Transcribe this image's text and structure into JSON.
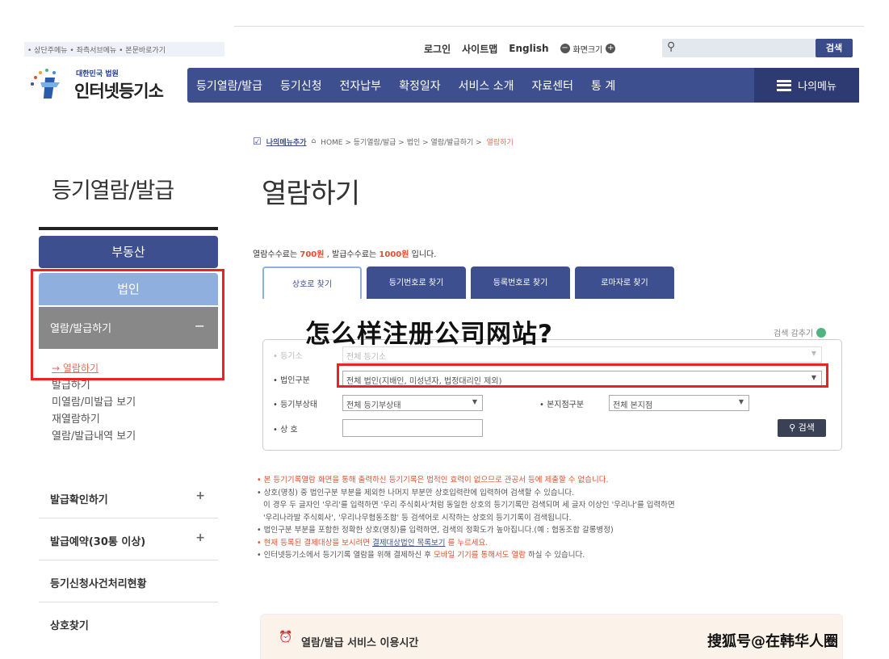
{
  "skip_links": "• 상단주메뉴 • 좌측서브메뉴 • 본문바로가기",
  "utils": {
    "login": "로그인",
    "sitemap": "사이트맵",
    "english": "English",
    "zoom": "화면크기",
    "minus": "−",
    "plus": "+",
    "search_btn": "검색"
  },
  "logo": {
    "small": "대한민국 법원",
    "big": "인터넷등기소"
  },
  "gnb": [
    "등기열람/발급",
    "등기신청",
    "전자납부",
    "확정일자",
    "서비스 소개",
    "자료센터",
    "통 계"
  ],
  "my_menu": "나의메뉴",
  "side": {
    "title": "등기열람/발급",
    "cat1": "부동산",
    "cat2": "법인",
    "selected": "열람/발급하기",
    "selected_toggle": "−",
    "sub": [
      "→ 열람하기",
      "발급하기",
      "미열람/미발급 보기",
      "재열람하기",
      "열람/발급내역 보기"
    ],
    "menus": [
      {
        "label": "발급확인하기",
        "toggle": "+"
      },
      {
        "label": "발급예약(30통 이상)",
        "toggle": "+"
      },
      {
        "label": "등기신청사건처리현황",
        "toggle": ""
      },
      {
        "label": "상호찾기",
        "toggle": ""
      }
    ]
  },
  "breadcrumb": {
    "add": "나의메뉴추가",
    "path": "HOME > 등기열람/발급 > 법인 > 열람/발급하기 >",
    "current": "열람하기"
  },
  "page_title": "열람하기",
  "fee": {
    "a": "열람수수료는",
    "v1": "700원",
    "b": ", 발급수수료는",
    "v2": "1000원",
    "c": "입니다."
  },
  "tabs": [
    "상호로 찾기",
    "등기번호로 찾기",
    "등록번호로 찾기",
    "로마자로 찾기"
  ],
  "fold": "검색 감추기",
  "form": {
    "office_label": "• 등기소",
    "office_val": "전체 등기소",
    "type_label": "• 법인구분",
    "type_val": "전체 법인(지배인, 미성년자, 법정대리인 제외)",
    "status_label": "• 등기부상태",
    "status_val": "전체 등기부상태",
    "branch_label": "• 본지점구분",
    "branch_val": "전체 본지점",
    "name_label": "• 상 호",
    "name_val": "",
    "search": "검색"
  },
  "overlay_title": "怎么样注册公司网站?",
  "notes": {
    "n1": "• 본 등기기록열람 화면을 통해 출력하신 등기기록은 법적인 효력이 없으므로 관공서 등에 제출할 수 없습니다.",
    "n2": "• 상호(명칭) 중 법인구분 부분을 제외한 나머지 부분만 상호입력란에 입력하여 검색할 수 있습니다.",
    "n2b": "이 경우 두 글자인 '우리'를 입력하면 '우리 주식회사'처럼 동일한 상호의 등기기록만 검색되며 세 글자 이상인 '우리나'를 입력하면",
    "n2c": "'우리나라발 주식회사', '우리나무협동조합' 등 검색어로 시작하는 상호의 등기기록이 검색됩니다.",
    "n3": "• 법인구분 부분을 포함한 정확한 상호(명칭)를 입력하면, 검색의 정확도가 높아집니다.(예 : 협동조합 갈롱병정)",
    "n4a": "• 현재 등록된 결제대상을 보시려면",
    "n4l": "결제대상법인 목록보기",
    "n4b": "를 누르세요.",
    "n5a": "• 인터넷등기소에서 등기기록 열람을 위해 결제하신 후",
    "n5r": "모바일 기기를 통해서도 열람",
    "n5b": "하실 수 있습니다."
  },
  "bottom_box": "열람/발급 서비스 이용시간",
  "watermark": "搜狐号@在韩华人圈"
}
